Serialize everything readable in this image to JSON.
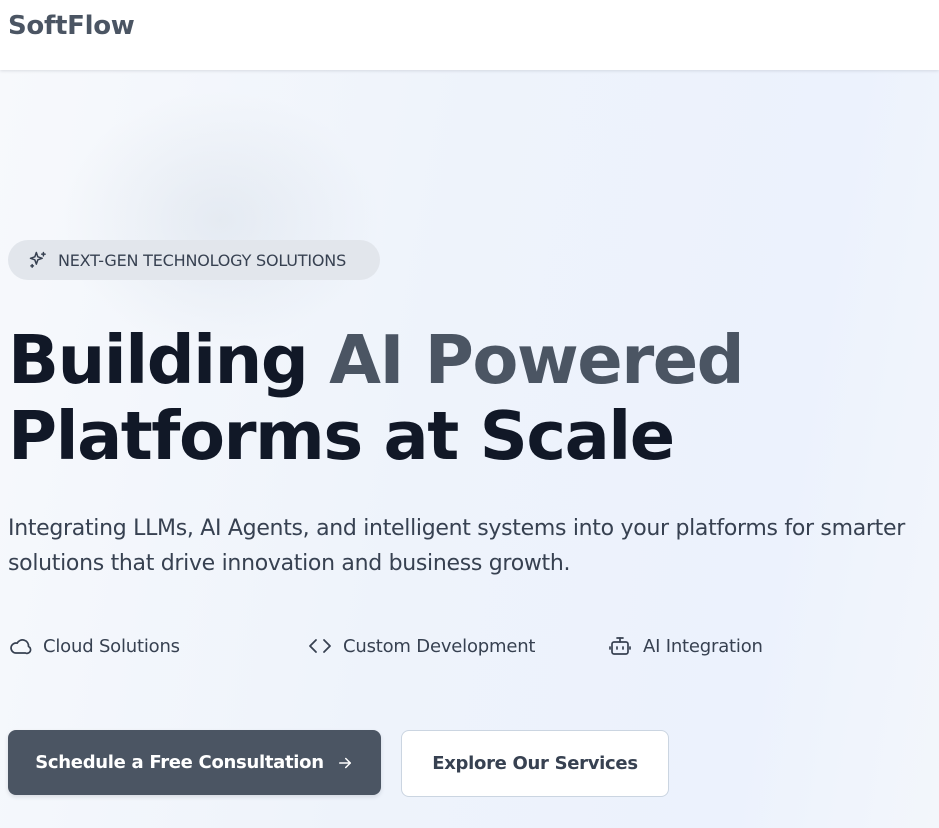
{
  "brand": {
    "name": "SoftFlow",
    "color": "#4b5563"
  },
  "hero": {
    "badge": {
      "icon": "sparkles-icon",
      "text": "NEXT-GEN TECHNOLOGY SOLUTIONS"
    },
    "headline": {
      "part1": "Building ",
      "highlight": "AI Powered",
      "line2": "Platforms at Scale"
    },
    "subtitle": "Integrating LLMs, AI Agents, and intelligent systems into your platforms for smarter solutions that drive innovation and business growth.",
    "features": [
      {
        "icon": "cloud-icon",
        "label": "Cloud Solutions"
      },
      {
        "icon": "code-icon",
        "label": "Custom Development"
      },
      {
        "icon": "bot-icon",
        "label": "AI Integration"
      }
    ],
    "cta": {
      "primary_label": "Schedule a Free Consultation",
      "primary_icon": "arrow-right-icon",
      "secondary_label": "Explore Our Services"
    }
  },
  "colors": {
    "heading": "#111827",
    "accent": "#4b5563",
    "highlight_underline": "#cbd2dc",
    "badge_bg": "#e2e6ec"
  }
}
